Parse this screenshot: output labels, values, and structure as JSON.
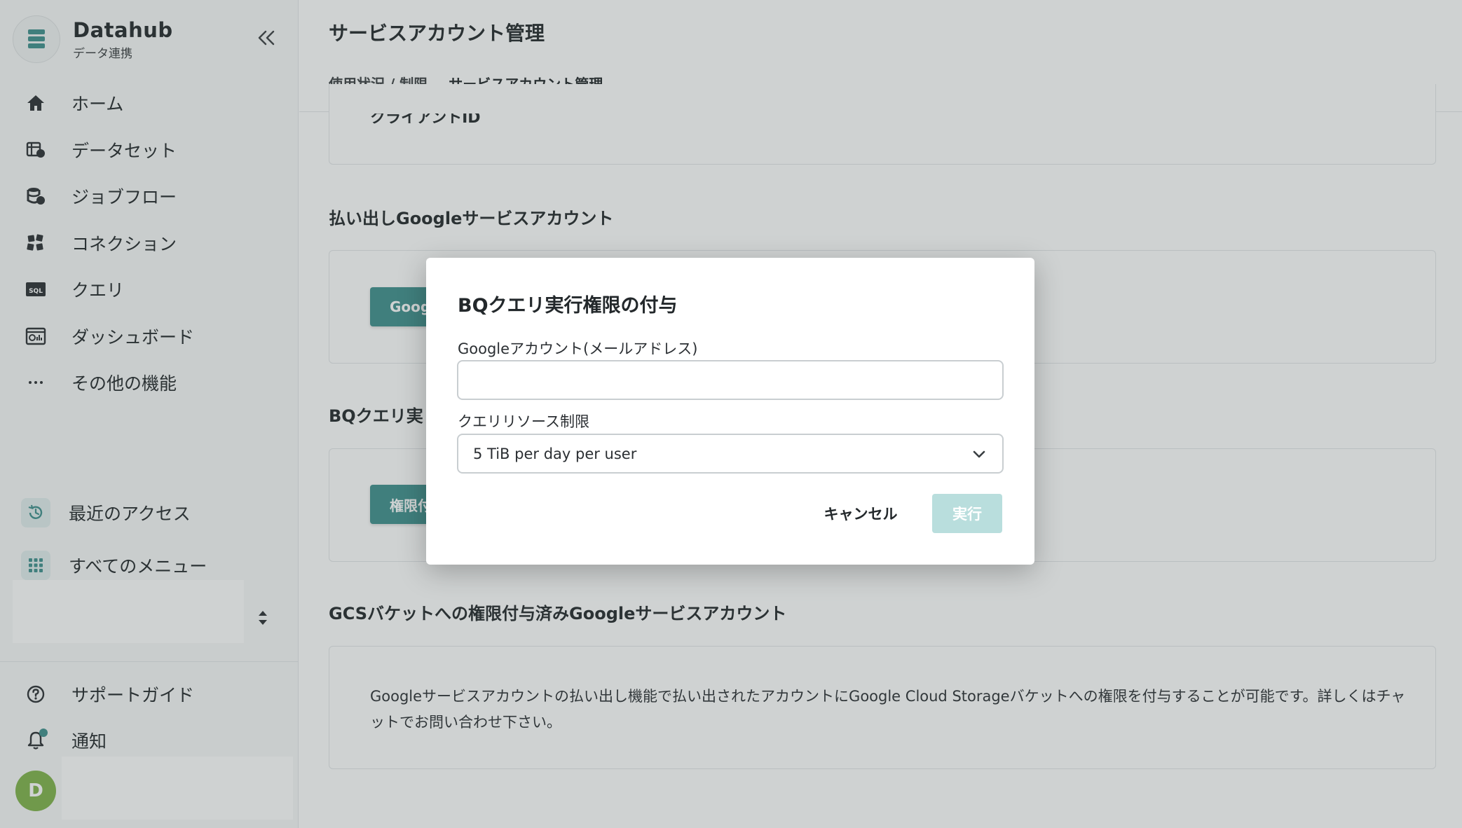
{
  "app": {
    "name": "Datahub",
    "subtitle": "データ連携"
  },
  "sidebar": {
    "items": [
      {
        "label": "ホーム",
        "icon": "home-icon"
      },
      {
        "label": "データセット",
        "icon": "dataset-icon"
      },
      {
        "label": "ジョブフロー",
        "icon": "jobflow-icon"
      },
      {
        "label": "コネクション",
        "icon": "connection-icon"
      },
      {
        "label": "クエリ",
        "icon": "sql-icon"
      },
      {
        "label": "ダッシュボード",
        "icon": "dashboard-icon"
      },
      {
        "label": "その他の機能",
        "icon": "more-icon"
      }
    ],
    "secondary": [
      {
        "label": "最近のアクセス",
        "icon": "history-icon"
      },
      {
        "label": "すべてのメニュー",
        "icon": "grid-icon"
      }
    ],
    "bottom": [
      {
        "label": "サポートガイド",
        "icon": "help-icon"
      },
      {
        "label": "通知",
        "icon": "bell-icon"
      }
    ],
    "avatar_initial": "D"
  },
  "header": {
    "title": "サービスアカウント管理",
    "tabs": [
      {
        "label": "使用状況 / 制限"
      },
      {
        "label": "サービスアカウント管理"
      }
    ]
  },
  "content": {
    "client_id_label": "クライアントID",
    "section_google_sa": "払い出しGoogleサービスアカウント",
    "google_button_partial": "Goog",
    "section_bq": "BQクエリ実",
    "bq_button_partial": "権限付",
    "section_gcs": "GCSバケットへの権限付与済みGoogleサービスアカウント",
    "gcs_description": "Googleサービスアカウントの払い出し機能で払い出されたアカウントにGoogle Cloud Storageバケットへの権限を付与することが可能です。詳しくはチャットでお問い合わせ下さい。"
  },
  "modal": {
    "title": "BQクエリ実行権限の付与",
    "email_label": "Googleアカウント(メールアドレス)",
    "email_value": "",
    "limit_label": "クエリリソース制限",
    "limit_value": "5 TiB per day per user",
    "cancel_label": "キャンセル",
    "run_label": "実行"
  },
  "colors": {
    "accent": "#3f8f8d",
    "accent_disabled": "#b9dedd",
    "avatar": "#7fb24a"
  }
}
